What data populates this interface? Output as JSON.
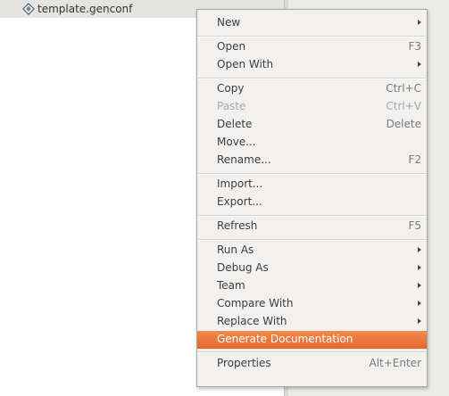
{
  "explorer": {
    "file_name": "template.genconf"
  },
  "context_menu": {
    "items": [
      {
        "label": "New",
        "accel": "",
        "submenu": true,
        "disabled": false
      },
      {
        "label": "Open",
        "accel": "F3",
        "submenu": false,
        "disabled": false
      },
      {
        "label": "Open With",
        "accel": "",
        "submenu": true,
        "disabled": false
      },
      {
        "label": "Copy",
        "accel": "Ctrl+C",
        "submenu": false,
        "disabled": false
      },
      {
        "label": "Paste",
        "accel": "Ctrl+V",
        "submenu": false,
        "disabled": true
      },
      {
        "label": "Delete",
        "accel": "Delete",
        "submenu": false,
        "disabled": false
      },
      {
        "label": "Move...",
        "accel": "",
        "submenu": false,
        "disabled": false
      },
      {
        "label": "Rename...",
        "accel": "F2",
        "submenu": false,
        "disabled": false
      },
      {
        "label": "Import...",
        "accel": "",
        "submenu": false,
        "disabled": false
      },
      {
        "label": "Export...",
        "accel": "",
        "submenu": false,
        "disabled": false
      },
      {
        "label": "Refresh",
        "accel": "F5",
        "submenu": false,
        "disabled": false
      },
      {
        "label": "Run As",
        "accel": "",
        "submenu": true,
        "disabled": false
      },
      {
        "label": "Debug As",
        "accel": "",
        "submenu": true,
        "disabled": false
      },
      {
        "label": "Team",
        "accel": "",
        "submenu": true,
        "disabled": false
      },
      {
        "label": "Compare With",
        "accel": "",
        "submenu": true,
        "disabled": false
      },
      {
        "label": "Replace With",
        "accel": "",
        "submenu": true,
        "disabled": false
      },
      {
        "label": "Generate Documentation",
        "accel": "",
        "submenu": false,
        "disabled": false,
        "highlighted": true
      },
      {
        "label": "Properties",
        "accel": "Alt+Enter",
        "submenu": false,
        "disabled": false
      }
    ]
  },
  "colors": {
    "highlight": "#e96d35",
    "menu_bg": "#f2f1f0"
  }
}
